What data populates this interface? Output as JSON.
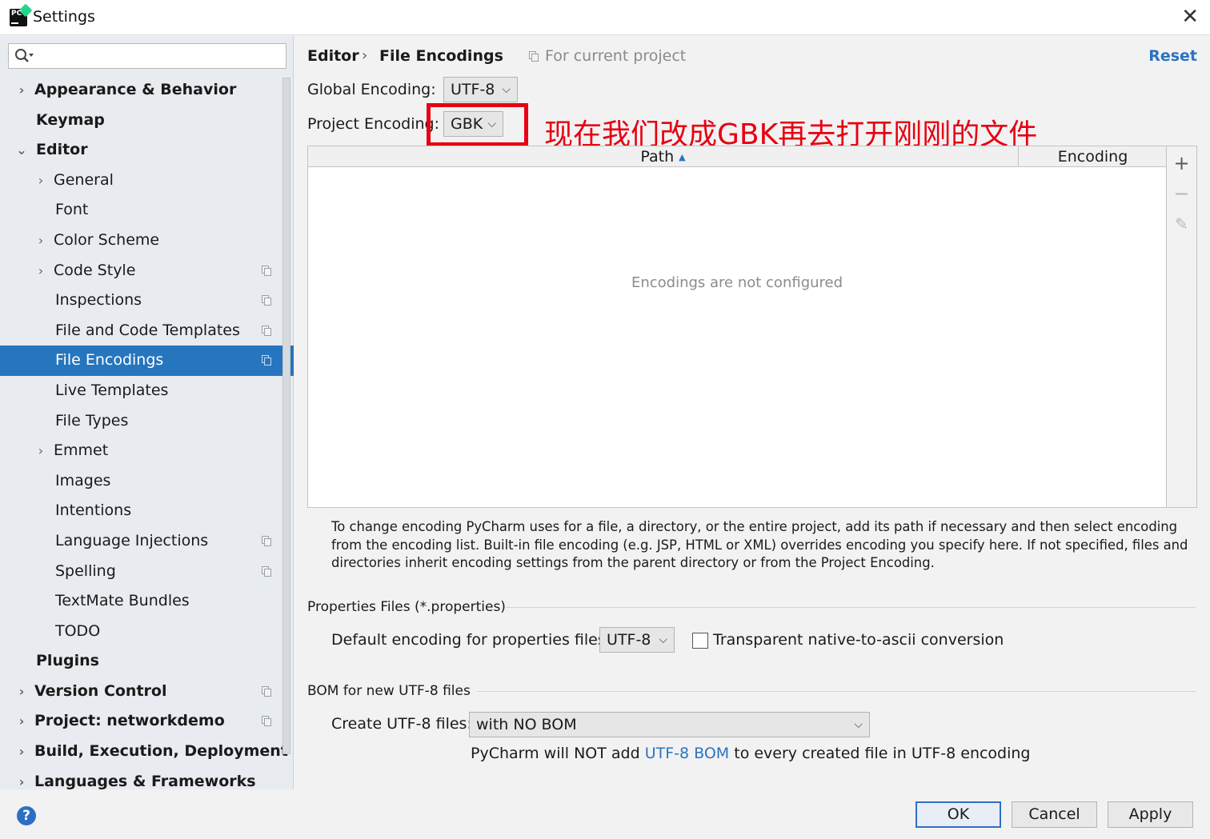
{
  "window": {
    "title": "Settings",
    "close_glyph": "✕",
    "app_icon_text": "PC"
  },
  "search": {
    "placeholder": "",
    "icon": "search-icon"
  },
  "sidebar": {
    "items": [
      {
        "label": "Appearance & Behavior",
        "bold": true,
        "level": 0,
        "arrow": "›",
        "copy": false
      },
      {
        "label": "Keymap",
        "bold": true,
        "level": 0,
        "arrow": "",
        "copy": false
      },
      {
        "label": "Editor",
        "bold": true,
        "level": 0,
        "arrow": "⌄",
        "copy": false
      },
      {
        "label": "General",
        "bold": false,
        "level": 1,
        "arrow": "›",
        "copy": false
      },
      {
        "label": "Font",
        "bold": false,
        "level": 1,
        "arrow": "",
        "copy": false
      },
      {
        "label": "Color Scheme",
        "bold": false,
        "level": 1,
        "arrow": "›",
        "copy": false
      },
      {
        "label": "Code Style",
        "bold": false,
        "level": 1,
        "arrow": "›",
        "copy": true
      },
      {
        "label": "Inspections",
        "bold": false,
        "level": 1,
        "arrow": "",
        "copy": true
      },
      {
        "label": "File and Code Templates",
        "bold": false,
        "level": 1,
        "arrow": "",
        "copy": true
      },
      {
        "label": "File Encodings",
        "bold": false,
        "level": 1,
        "arrow": "",
        "copy": true,
        "selected": true
      },
      {
        "label": "Live Templates",
        "bold": false,
        "level": 1,
        "arrow": "",
        "copy": false
      },
      {
        "label": "File Types",
        "bold": false,
        "level": 1,
        "arrow": "",
        "copy": false
      },
      {
        "label": "Emmet",
        "bold": false,
        "level": 1,
        "arrow": "›",
        "copy": false
      },
      {
        "label": "Images",
        "bold": false,
        "level": 1,
        "arrow": "",
        "copy": false
      },
      {
        "label": "Intentions",
        "bold": false,
        "level": 1,
        "arrow": "",
        "copy": false
      },
      {
        "label": "Language Injections",
        "bold": false,
        "level": 1,
        "arrow": "",
        "copy": true
      },
      {
        "label": "Spelling",
        "bold": false,
        "level": 1,
        "arrow": "",
        "copy": true
      },
      {
        "label": "TextMate Bundles",
        "bold": false,
        "level": 1,
        "arrow": "",
        "copy": false
      },
      {
        "label": "TODO",
        "bold": false,
        "level": 1,
        "arrow": "",
        "copy": false
      },
      {
        "label": "Plugins",
        "bold": true,
        "level": 0,
        "arrow": "",
        "copy": false
      },
      {
        "label": "Version Control",
        "bold": true,
        "level": 0,
        "arrow": "›",
        "copy": true
      },
      {
        "label": "Project: networkdemo",
        "bold": true,
        "level": 0,
        "arrow": "›",
        "copy": true
      },
      {
        "label": "Build, Execution, Deployment",
        "bold": true,
        "level": 0,
        "arrow": "›",
        "copy": false
      },
      {
        "label": "Languages & Frameworks",
        "bold": true,
        "level": 0,
        "arrow": "›",
        "copy": false
      }
    ]
  },
  "header": {
    "crumb_1": "Editor",
    "separator": "›",
    "crumb_2": "File Encodings",
    "for_project": "For current project",
    "reset": "Reset"
  },
  "encoding": {
    "global_label": "Global Encoding:",
    "global_value": "UTF-8",
    "project_label": "Project Encoding:",
    "project_value": "GBK",
    "chevron": "⌵"
  },
  "annotation": {
    "text": "现在我们改成GBK再去打开刚刚的文件",
    "color": "#e60012"
  },
  "table": {
    "col_path": "Path",
    "col_encoding": "Encoding",
    "sort_glyph": "▲",
    "empty": "Encodings are not configured",
    "toolbar": {
      "add": "+",
      "remove": "−",
      "edit": "✎"
    }
  },
  "help_text": "To change encoding PyCharm uses for a file, a directory, or the entire project, add its path if necessary and then select encoding from the encoding list. Built-in file encoding (e.g. JSP, HTML or XML) overrides encoding you specify here. If not specified, files and directories inherit encoding settings from the parent directory or from the Project Encoding.",
  "properties": {
    "title": "Properties Files (*.properties)",
    "default_label": "Default encoding for properties files:",
    "default_value": "UTF-8",
    "transparent_label": "Transparent native-to-ascii conversion",
    "transparent_checked": false
  },
  "bom": {
    "title": "BOM for new UTF-8 files",
    "create_label": "Create UTF-8 files:",
    "create_value": "with NO BOM",
    "note_before": "PyCharm will NOT add ",
    "note_link": "UTF-8 BOM",
    "note_after": " to every created file in UTF-8 encoding"
  },
  "footer": {
    "help": "?",
    "ok": "OK",
    "cancel": "Cancel",
    "apply": "Apply"
  },
  "colors": {
    "accent": "#2675bf",
    "link": "#2a73c2",
    "annotation": "#e60012"
  }
}
